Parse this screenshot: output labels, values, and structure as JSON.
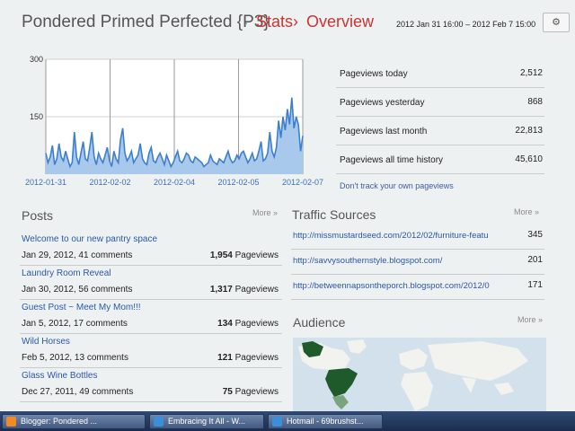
{
  "header": {
    "blog_title": "Pondered Primed Perfected {P3}",
    "separator": "·",
    "crumbs": [
      "Stats",
      "Overview"
    ],
    "crumb_sep": "›",
    "date_range": "2012 Jan 31 16:00 – 2012 Feb 7 15:00",
    "settings_icon": "gear-icon"
  },
  "chart_data": {
    "type": "area",
    "x_ticks": [
      "2012-01-31",
      "2012-02-02",
      "2012-02-04",
      "2012-02-05",
      "2012-02-07"
    ],
    "y_ticks": [
      300,
      150
    ],
    "ylim": [
      0,
      300
    ],
    "grid": true,
    "color": "#3d7fcf",
    "values": [
      55,
      30,
      45,
      75,
      25,
      40,
      80,
      45,
      35,
      60,
      40,
      20,
      30,
      110,
      45,
      25,
      55,
      85,
      40,
      35,
      70,
      110,
      45,
      25,
      55,
      40,
      30,
      50,
      70,
      35,
      20,
      60,
      40,
      30,
      90,
      120,
      55,
      35,
      45,
      60,
      30,
      40,
      50,
      80,
      40,
      30,
      25,
      55,
      70,
      35,
      30,
      45,
      55,
      40,
      25,
      50,
      35,
      20,
      30,
      45,
      60,
      35,
      30,
      40,
      55,
      50,
      35,
      30,
      45,
      40,
      35,
      30,
      20,
      25,
      30,
      50,
      35,
      30,
      25,
      40,
      35,
      30,
      45,
      60,
      40,
      30,
      35,
      50,
      40,
      55,
      60,
      45,
      30,
      40,
      55,
      35,
      40,
      60,
      85,
      35,
      40,
      55,
      110,
      60,
      45,
      70,
      140,
      95,
      150,
      115,
      170,
      130,
      200,
      120,
      150,
      130,
      60,
      100
    ]
  },
  "stats": {
    "rows": [
      {
        "label": "Pageviews today",
        "value": "2,512"
      },
      {
        "label": "Pageviews yesterday",
        "value": "868"
      },
      {
        "label": "Pageviews last month",
        "value": "22,813"
      },
      {
        "label": "Pageviews all time history",
        "value": "45,610"
      }
    ],
    "link": "Don't track your own pageviews"
  },
  "posts": {
    "title": "Posts",
    "more": "More »",
    "items": [
      {
        "title": "Welcome to our new pantry space",
        "meta": "Jan 29, 2012, 41 comments",
        "views": "1,954",
        "views_unit": "Pageviews"
      },
      {
        "title": "Laundry Room Reveal",
        "meta": "Jan 30, 2012, 56 comments",
        "views": "1,317",
        "views_unit": "Pageviews"
      },
      {
        "title": "Guest Post ~ Meet My Mom!!!",
        "meta": "Jan 5, 2012, 17 comments",
        "views": "134",
        "views_unit": "Pageviews"
      },
      {
        "title": "Wild Horses",
        "meta": "Feb 5, 2012, 13 comments",
        "views": "121",
        "views_unit": "Pageviews"
      },
      {
        "title": "Glass Wine Bottles",
        "meta": "Dec 27, 2011, 49 comments",
        "views": "75",
        "views_unit": "Pageviews"
      }
    ]
  },
  "traffic": {
    "title": "Traffic Sources",
    "more": "More »",
    "items": [
      {
        "url": "http://missmustardseed.com/2012/02/furniture-featu",
        "value": "345"
      },
      {
        "url": "http://savvysouthernstyle.blogspot.com/",
        "value": "201"
      },
      {
        "url": "http://betweennapsontheporch.blogspot.com/2012/0",
        "value": "171"
      }
    ]
  },
  "audience": {
    "title": "Audience",
    "more": "More »",
    "colors": {
      "water": "#d3e1ec",
      "land": "#f2f2ee",
      "highlight": "#1f5a2a",
      "light": "#7aa37f"
    }
  },
  "taskbar": {
    "items": [
      {
        "label": "Blogger: Pondered ...",
        "icon": "blogger-icon",
        "color": "#f08a24"
      },
      {
        "label": "Embracing It All - W...",
        "icon": "ie-icon",
        "color": "#3b8fd9"
      },
      {
        "label": "Hotmail - 69brushst...",
        "icon": "ie-icon",
        "color": "#3b8fd9"
      }
    ]
  }
}
